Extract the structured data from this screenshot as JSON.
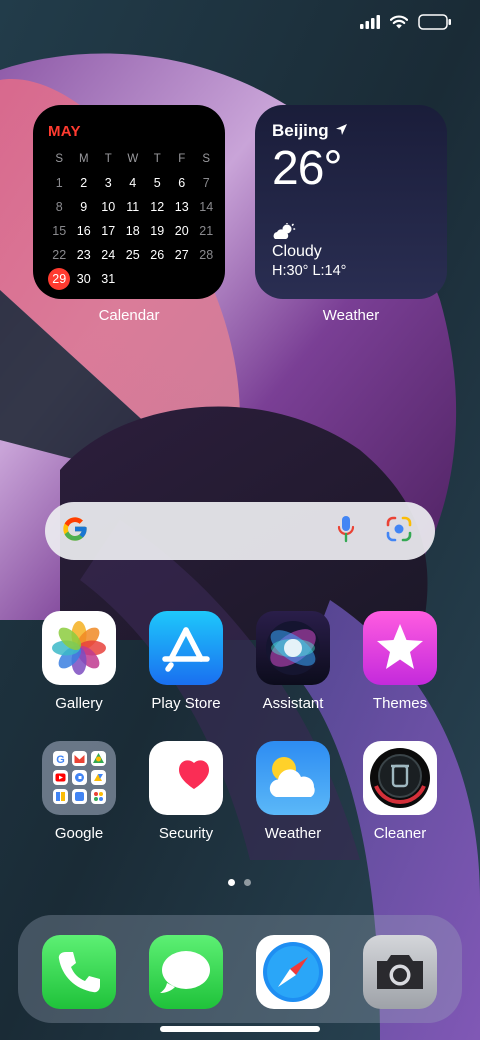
{
  "status_bar": {
    "icons": [
      "cellular-signal-icon",
      "wifi-icon",
      "battery-icon"
    ]
  },
  "widgets": {
    "calendar": {
      "month": "MAY",
      "label": "Calendar",
      "weekdays": [
        "S",
        "M",
        "T",
        "W",
        "T",
        "F",
        "S"
      ],
      "days": [
        {
          "d": "1",
          "dim": true
        },
        {
          "d": "2"
        },
        {
          "d": "3"
        },
        {
          "d": "4"
        },
        {
          "d": "5"
        },
        {
          "d": "6"
        },
        {
          "d": "7",
          "dim": true
        },
        {
          "d": "8",
          "dim": true
        },
        {
          "d": "9"
        },
        {
          "d": "10"
        },
        {
          "d": "11"
        },
        {
          "d": "12"
        },
        {
          "d": "13"
        },
        {
          "d": "14",
          "dim": true
        },
        {
          "d": "15",
          "dim": true
        },
        {
          "d": "16"
        },
        {
          "d": "17"
        },
        {
          "d": "18"
        },
        {
          "d": "19"
        },
        {
          "d": "20"
        },
        {
          "d": "21",
          "dim": true
        },
        {
          "d": "22",
          "dim": true
        },
        {
          "d": "23"
        },
        {
          "d": "24"
        },
        {
          "d": "25"
        },
        {
          "d": "26"
        },
        {
          "d": "27"
        },
        {
          "d": "28",
          "dim": true
        },
        {
          "d": "29",
          "today": true
        },
        {
          "d": "30"
        },
        {
          "d": "31"
        }
      ],
      "accent": "#ff3b30"
    },
    "weather": {
      "city": "Beijing",
      "temperature": "26°",
      "condition": "Cloudy",
      "high_low": "H:30°  L:14°",
      "label": "Weather",
      "icons": [
        "location-arrow-icon",
        "partly-cloudy-icon"
      ]
    }
  },
  "search": {
    "icons": [
      "google-g-icon",
      "microphone-icon",
      "google-lens-icon"
    ]
  },
  "apps": [
    {
      "label": "Gallery",
      "icon": "gallery-icon"
    },
    {
      "label": "Play Store",
      "icon": "app-store-icon"
    },
    {
      "label": "Assistant",
      "icon": "siri-icon"
    },
    {
      "label": "Themes",
      "icon": "star-icon"
    },
    {
      "label": "Google",
      "icon": "google-folder-icon"
    },
    {
      "label": "Security",
      "icon": "heart-icon"
    },
    {
      "label": "Weather",
      "icon": "sun-cloud-icon"
    },
    {
      "label": "Cleaner",
      "icon": "cleaner-icon"
    }
  ],
  "page_indicator": {
    "pages": 2,
    "current": 1
  },
  "dock": [
    {
      "icon": "phone-icon"
    },
    {
      "icon": "messages-icon"
    },
    {
      "icon": "safari-compass-icon"
    },
    {
      "icon": "camera-icon"
    }
  ]
}
